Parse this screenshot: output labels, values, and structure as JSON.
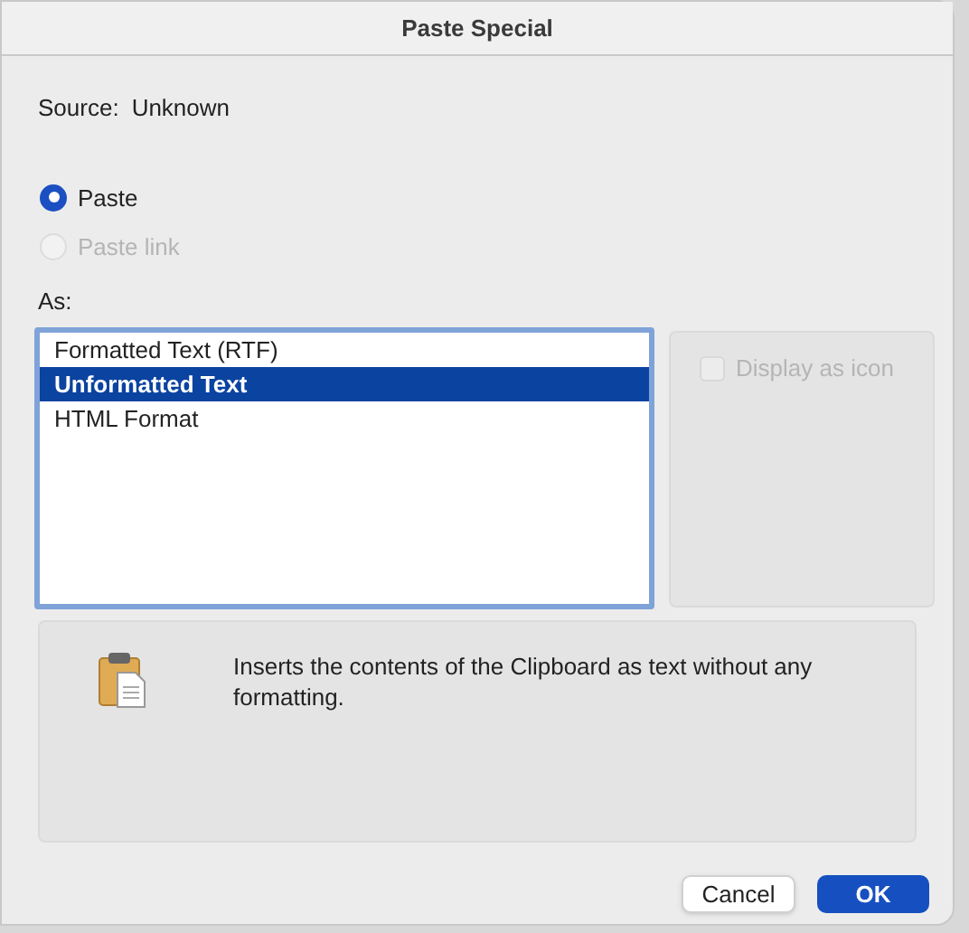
{
  "window": {
    "title": "Paste Special"
  },
  "source": {
    "label": "Source:",
    "value": "Unknown"
  },
  "paste_options": [
    {
      "label": "Paste",
      "selected": true,
      "disabled": false
    },
    {
      "label": "Paste link",
      "selected": false,
      "disabled": true
    }
  ],
  "as_label": "As:",
  "formats": [
    {
      "label": "Formatted Text (RTF)",
      "selected": false
    },
    {
      "label": "Unformatted Text",
      "selected": true
    },
    {
      "label": "HTML Format",
      "selected": false
    }
  ],
  "display_as_icon": {
    "label": "Display as icon",
    "checked": false,
    "disabled": true
  },
  "description": "Inserts the contents of the Clipboard as text without any formatting.",
  "buttons": [
    {
      "label": "Cancel",
      "kind": "secondary"
    },
    {
      "label": "OK",
      "kind": "primary"
    }
  ]
}
